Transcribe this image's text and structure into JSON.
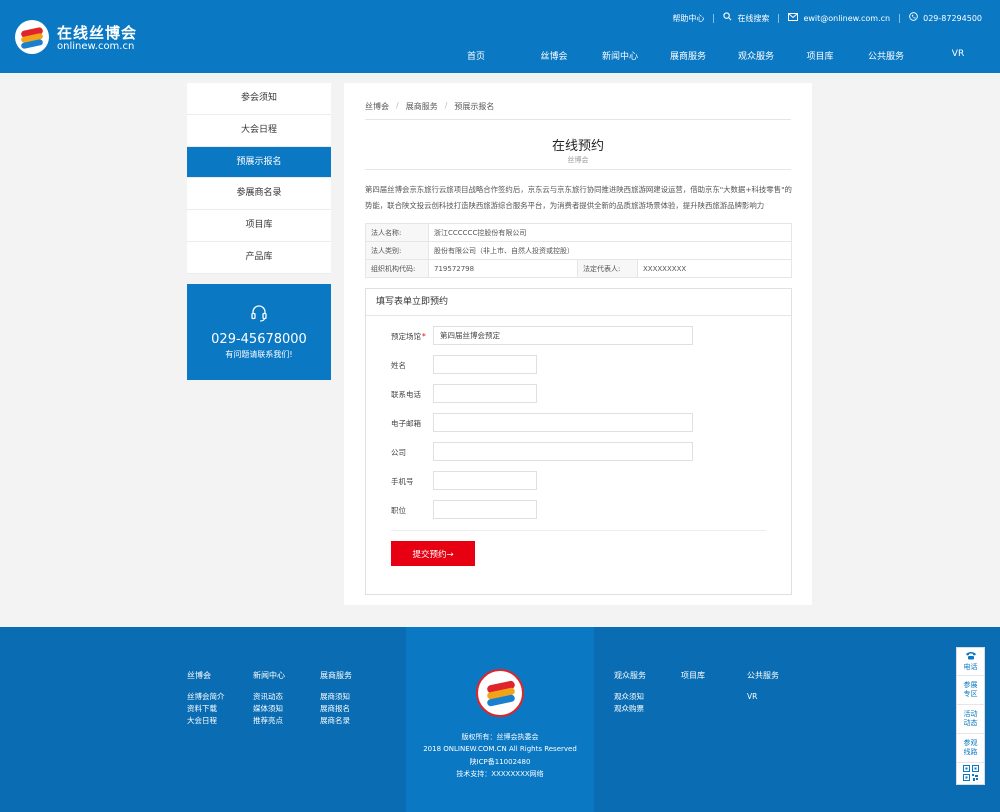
{
  "brand": {
    "title": "在线丝博会",
    "subtitle": "onlinew.com.cn"
  },
  "topbar": {
    "help": "帮助中心",
    "search": "在线搜索",
    "email": "ewit@onlinew.com.cn",
    "phone": "029-87294500"
  },
  "nav": [
    "首页",
    "丝博会",
    "新闻中心",
    "展商服务",
    "观众服务",
    "项目库",
    "公共服务",
    "VR"
  ],
  "sidebar": {
    "items": [
      "参会须知",
      "大会日程",
      "预展示报名",
      "参展商名录",
      "项目库",
      "产品库"
    ],
    "active_index": 2
  },
  "contact": {
    "phone": "029-45678000",
    "tip": "有问题请联系我们!"
  },
  "breadcrumb": [
    "丝博会",
    "展商服务",
    "预展示报名"
  ],
  "page": {
    "title": "在线预约",
    "subtitle": "丝博会",
    "intro": "第四届丝博会京东旅行云旅项目战略合作签约后，京东云与京东旅行协同推进陕西旅游网建设运营，借助京东\"大数据+科技零售\"的势能，联合陕文投云创科技打造陕西旅游综合服务平台，为消费者提供全新的品质旅游场景体验，提升陕西旅游品牌影响力"
  },
  "company_info": {
    "name_label": "法人名称:",
    "name_value": "浙江CCCCCC控股份有限公司",
    "type_label": "法人类别:",
    "type_value": "股份有限公司（非上市、自然人投资或控股）",
    "org_label": "组织机构代码:",
    "org_value": "719572798",
    "rep_label": "法定代表人:",
    "rep_value": "XXXXXXXXX"
  },
  "form": {
    "heading": "填写表单立即预约",
    "fields": [
      {
        "label": "预定场馆",
        "required": true,
        "value": "第四届丝博会预定"
      },
      {
        "label": "姓名",
        "value": ""
      },
      {
        "label": "联系电话",
        "value": ""
      },
      {
        "label": "电子邮箱",
        "value": ""
      },
      {
        "label": "公司",
        "value": ""
      },
      {
        "label": "手机号",
        "value": ""
      },
      {
        "label": "职位",
        "value": ""
      }
    ],
    "required_mark": "*",
    "submit_label": "提交预约→"
  },
  "footer": {
    "cols": [
      {
        "heading": "丝博会",
        "links": [
          "丝博会简介",
          "资料下载",
          "大会日程"
        ]
      },
      {
        "heading": "新闻中心",
        "links": [
          "资讯动态",
          "媒体须知",
          "推荐亮点"
        ]
      },
      {
        "heading": "展商服务",
        "links": [
          "展商须知",
          "展商报名",
          "展商名录"
        ]
      },
      {
        "heading": "观众服务",
        "links": [
          "观众须知",
          "观众购票"
        ]
      },
      {
        "heading": "项目库",
        "links": []
      },
      {
        "heading": "公共服务",
        "links": [
          "VR"
        ]
      }
    ],
    "copyright": [
      "版权所有：丝博会执委会",
      "2018 ONLINEW.COM.CN All Rights Reserved",
      "陕ICP备11002480",
      "技术支持：XXXXXXXX网络"
    ]
  },
  "floatbar": {
    "phone": "电话",
    "item2": [
      "参展",
      "专区"
    ],
    "item3": [
      "活动",
      "动态"
    ],
    "item4": [
      "参观",
      "线路"
    ]
  },
  "colors": {
    "primary": "#0a78c3",
    "footer": "#0a6db3",
    "submit": "#e60012",
    "background": "#f3f3f3"
  }
}
